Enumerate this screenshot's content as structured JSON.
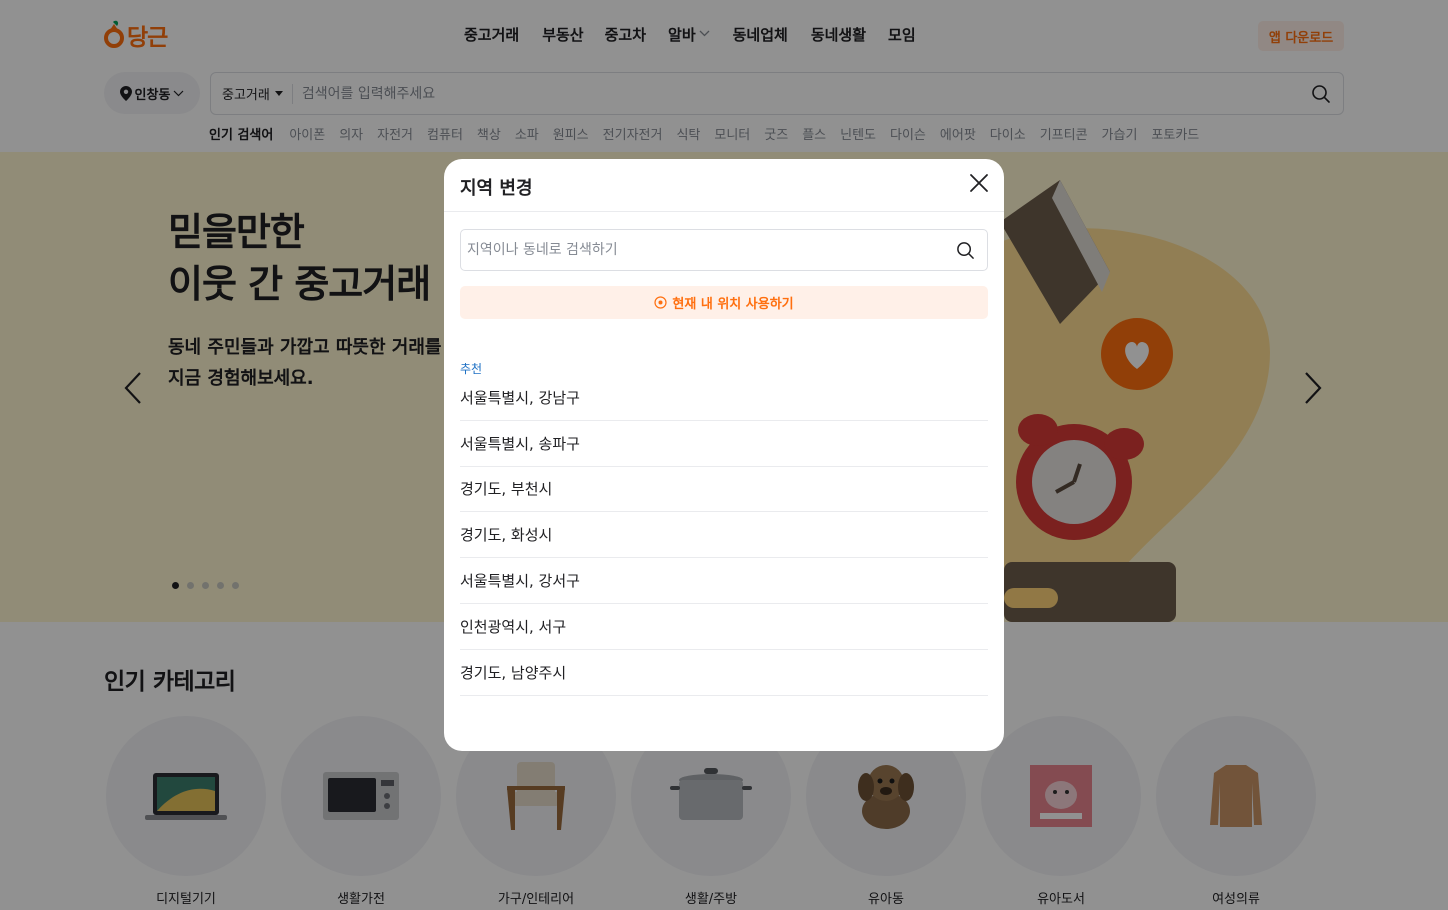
{
  "brand": {
    "name": "당근",
    "color": "#ff6f0f"
  },
  "nav": {
    "items": [
      {
        "label": "중고거래"
      },
      {
        "label": "부동산"
      },
      {
        "label": "중고차"
      },
      {
        "label": "알바"
      },
      {
        "label": "동네업체"
      },
      {
        "label": "동네생활"
      },
      {
        "label": "모임"
      }
    ],
    "app_download": "앱 다운로드"
  },
  "location_button": {
    "label": "인창동",
    "icon": "map-pin-icon"
  },
  "search": {
    "category": "중고거래",
    "placeholder": "검색어를 입력해주세요"
  },
  "popular": {
    "title": "인기 검색어",
    "keywords": [
      "아이폰",
      "의자",
      "자전거",
      "컴퓨터",
      "책상",
      "소파",
      "원피스",
      "전기자전거",
      "식탁",
      "모니터",
      "굿즈",
      "플스",
      "닌텐도",
      "다이슨",
      "에어팟",
      "다이소",
      "기프티콘",
      "가습기",
      "포토카드"
    ]
  },
  "hero": {
    "title_line1": "믿을만한",
    "title_line2": "이웃 간 중고거래",
    "sub_line1": "동네 주민들과 가깝고 따뜻한 거래를",
    "sub_line2": "지금 경험해보세요.",
    "background": "#fff6d1",
    "slides_total": 5,
    "active_slide": 1
  },
  "categories": {
    "heading": "인기 카테고리",
    "items": [
      {
        "label": "디지털기기",
        "icon": "laptop-icon"
      },
      {
        "label": "생활가전",
        "icon": "microwave-icon"
      },
      {
        "label": "가구/인테리어",
        "icon": "armchair-icon"
      },
      {
        "label": "생활/주방",
        "icon": "pot-icon"
      },
      {
        "label": "유아동",
        "icon": "plush-dog-icon"
      },
      {
        "label": "유아도서",
        "icon": "kids-book-icon"
      },
      {
        "label": "여성의류",
        "icon": "sweater-icon"
      }
    ]
  },
  "modal": {
    "title": "지역 변경",
    "search_placeholder": "지역이나 동네로 검색하기",
    "current_location": "현재 내 위치 사용하기",
    "recommended_label": "추천",
    "recommended": [
      "서울특별시, 강남구",
      "서울특별시, 송파구",
      "경기도, 부천시",
      "경기도, 화성시",
      "서울특별시, 강서구",
      "인천광역시, 서구",
      "경기도, 남양주시"
    ]
  }
}
